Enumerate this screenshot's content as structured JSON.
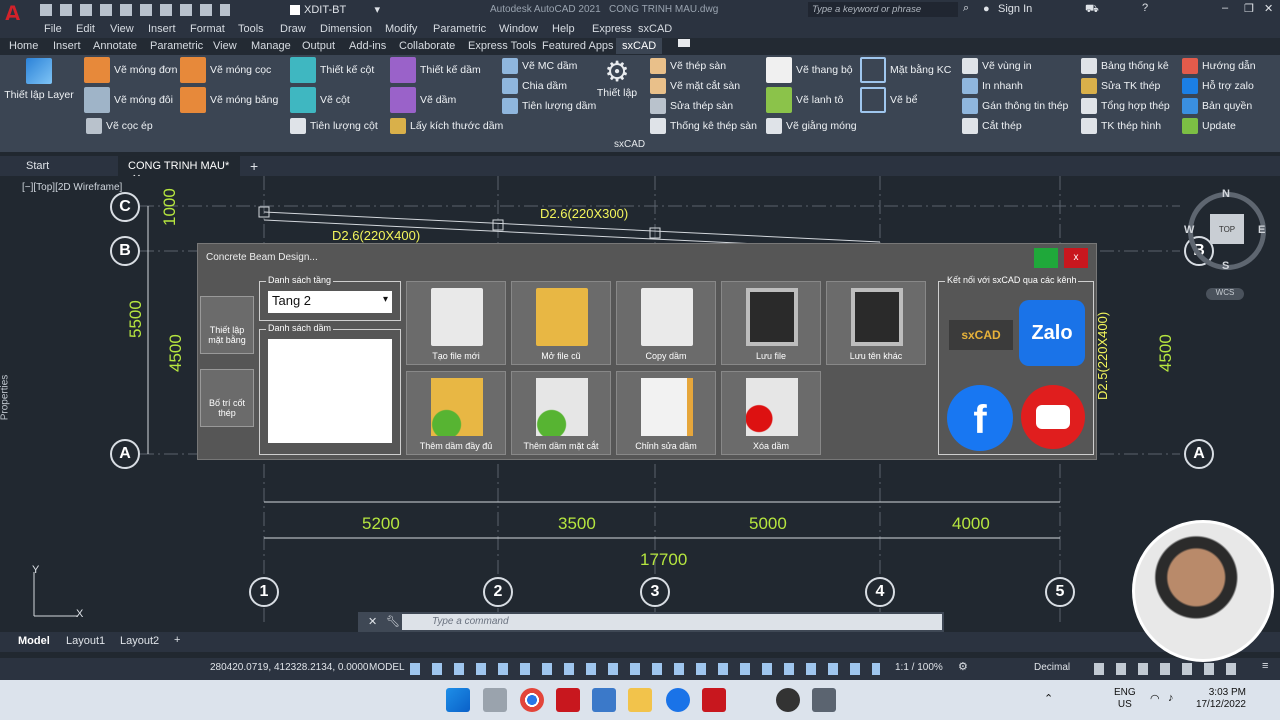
{
  "window": {
    "title": "Autodesk AutoCAD 2021",
    "file": "CONG TRINH MAU.dwg",
    "search_placeholder": "Type a keyword or phrase",
    "sign_in": "Sign In",
    "workspace": "XDIT-BT"
  },
  "menu": [
    "File",
    "Edit",
    "View",
    "Insert",
    "Format",
    "Tools",
    "Draw",
    "Dimension",
    "Modify",
    "Parametric",
    "Window",
    "Help",
    "Express",
    "sxCAD"
  ],
  "ribbon_tabs": [
    "Home",
    "Insert",
    "Annotate",
    "Parametric",
    "View",
    "Manage",
    "Output",
    "Add-ins",
    "Collaborate",
    "Express Tools",
    "Featured Apps",
    "sxCAD"
  ],
  "ribbon": {
    "layer": "Thiết lập Layer",
    "items": [
      "Vẽ móng đơn",
      "Vẽ móng cọc",
      "Vẽ móng đôi",
      "Vẽ móng băng",
      "Vẽ cọc ép",
      "Thiết kế cột",
      "Vẽ cột",
      "Tiên lượng cột",
      "Thiết kế dầm",
      "Vẽ dầm",
      "Lấy kích thước dầm",
      "Vẽ MC dầm",
      "Chia dầm",
      "Tiên lượng dầm",
      "Thiết lập",
      "Vẽ thép sàn",
      "Vẽ mặt cắt sàn",
      "Sửa thép sàn",
      "Thống kê thép sàn",
      "Vẽ thang bộ",
      "Vẽ lanh tô",
      "Vẽ giằng móng",
      "Mặt bằng KC",
      "Vẽ bể",
      "Vẽ vùng in",
      "In nhanh",
      "Gán thông tin thép",
      "Cắt thép",
      "Bảng thống kê",
      "Sửa TK thép",
      "Tổng hợp thép",
      "TK thép hình",
      "Hướng dẫn",
      "Hỗ trợ zalo",
      "Bản quyền",
      "Update"
    ],
    "panel": "sxCAD"
  },
  "doc_tabs": {
    "start": "Start",
    "active": "CONG TRINH MAU*"
  },
  "viewport_label": "[−][Top][2D Wireframe]",
  "properties": "Properties",
  "drawing": {
    "grid_letters": [
      "C",
      "B",
      "A"
    ],
    "grid_numbers": [
      "1",
      "2",
      "3",
      "4",
      "5"
    ],
    "dims_bottom": [
      "5200",
      "3500",
      "5000",
      "4000"
    ],
    "total": "17700",
    "dims_left": [
      "1000",
      "5500",
      "4500"
    ],
    "dim_right": "4500",
    "beam_labels": [
      "D2.6(220X300)",
      "D2.6(220X400)",
      "D2.5(220X400)"
    ]
  },
  "viewcube": {
    "n": "N",
    "s": "S",
    "e": "E",
    "w": "W",
    "top": "TOP",
    "wcs": "WCS"
  },
  "ucs": {
    "x": "X",
    "y": "Y"
  },
  "dialog": {
    "title": "Concrete Beam Design...",
    "side_buttons": [
      "Thiết lập mặt bằng",
      "Bố trí cốt thép"
    ],
    "floor_group": "Danh sách tầng",
    "floor_value": "Tang 2",
    "beam_group": "Danh sách dầm",
    "buttons": [
      "Tạo file mới",
      "Mở file cũ",
      "Copy dầm",
      "Lưu file",
      "Lưu tên khác",
      "Thêm dầm đầy đủ",
      "Thêm dầm mặt cắt",
      "Chỉnh sửa dầm",
      "Xóa dầm"
    ],
    "connect_group": "Kết nối với sxCAD qua các kênh",
    "channels": [
      "sxCAD",
      "Zalo",
      "Facebook",
      "YouTube"
    ]
  },
  "command": {
    "placeholder": "Type a command"
  },
  "layouts": [
    "Model",
    "Layout1",
    "Layout2"
  ],
  "status": {
    "coords": "280420.0719, 412328.2134, 0.0000",
    "model": "MODEL",
    "scale": "1:1 / 100%",
    "units": "Decimal"
  },
  "taskbar": {
    "lang1": "ENG",
    "lang2": "US",
    "time": "3:03 PM",
    "date": "17/12/2022"
  },
  "colors": {
    "accent_red": "#c8171e",
    "dim_green": "#b6e63f",
    "canvas": "#212830"
  }
}
